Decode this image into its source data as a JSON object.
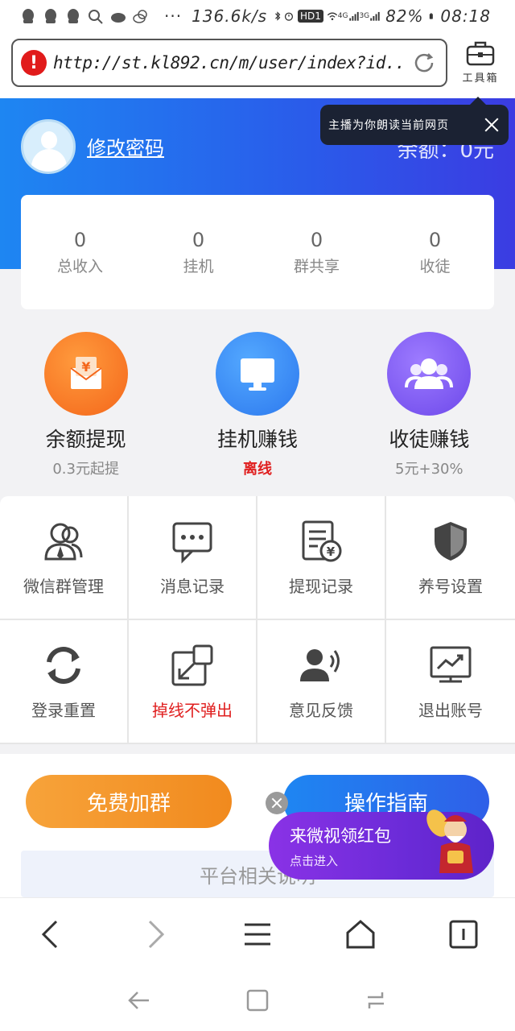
{
  "status_bar": {
    "speed": "136.6k/s",
    "signal_hd": "HD1",
    "net_4g": "4G",
    "net_3g": "3G",
    "battery": "82%",
    "time": "08:18"
  },
  "browser": {
    "url": "http://st.kl892.cn/m/user/index?id...",
    "toolbox_label": "工具箱",
    "tip_text": "主播为你朗读当前网页"
  },
  "header": {
    "change_password": "修改密码",
    "balance": "余额：0元"
  },
  "stats": [
    {
      "value": "0",
      "label": "总收入"
    },
    {
      "value": "0",
      "label": "挂机"
    },
    {
      "value": "0",
      "label": "群共享"
    },
    {
      "value": "0",
      "label": "收徒"
    }
  ],
  "features": [
    {
      "title": "余额提现",
      "sub": "0.3元起提",
      "icon": "yen-envelope-icon",
      "color": "#f4661a"
    },
    {
      "title": "挂机赚钱",
      "sub": "离线",
      "icon": "monitor-icon",
      "color": "#2c78ee"
    },
    {
      "title": "收徒赚钱",
      "sub": "5元+30%",
      "icon": "users-icon",
      "color": "#6d48ea"
    }
  ],
  "grid": [
    {
      "label": "微信群管理",
      "icon": "group-manage-icon"
    },
    {
      "label": "消息记录",
      "icon": "message-icon"
    },
    {
      "label": "提现记录",
      "icon": "withdraw-record-icon"
    },
    {
      "label": "养号设置",
      "icon": "shield-icon"
    },
    {
      "label": "登录重置",
      "icon": "refresh-icon"
    },
    {
      "label": "掉线不弹出",
      "icon": "popout-icon",
      "accent": "#e02020"
    },
    {
      "label": "意见反馈",
      "icon": "feedback-icon"
    },
    {
      "label": "退出账号",
      "icon": "chart-logout-icon"
    }
  ],
  "buttons": {
    "join_group": "免费加群",
    "guide": "操作指南"
  },
  "info_box": "平台相关说明",
  "promo": {
    "title": "来微视领红包",
    "subtitle": "点击进入"
  }
}
